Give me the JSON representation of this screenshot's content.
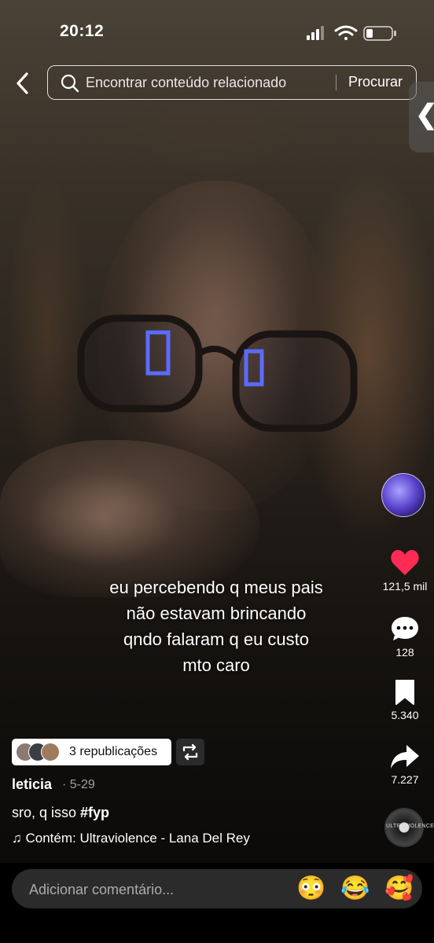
{
  "status_bar": {
    "time": "20:12"
  },
  "search": {
    "placeholder": "Encontrar conteúdo relacionado",
    "button_label": "Procurar"
  },
  "caption": [
    "eu percebendo q meus pais",
    "não estavam brincando",
    "qndo falaram q eu custo",
    "mto caro"
  ],
  "actions": {
    "likes": "121,5 mil",
    "comments": "128",
    "bookmarks": "5.340",
    "shares": "7.227"
  },
  "reposts_label": "3 republicações",
  "post": {
    "username": "leticia",
    "date": "· 5-29",
    "description_text": "sro, q isso ",
    "hashtag": "#fyp",
    "music": "Contém: Ultraviolence - Lana Del Rey",
    "disc_label": "ULTRAVIOLENCE"
  },
  "comment": {
    "placeholder": "Adicionar comentário...",
    "emojis": [
      "😳",
      "😂",
      "🥰"
    ]
  },
  "colors": {
    "like_red": "#ff2b54",
    "bar_bg": "#2b2b2b"
  }
}
